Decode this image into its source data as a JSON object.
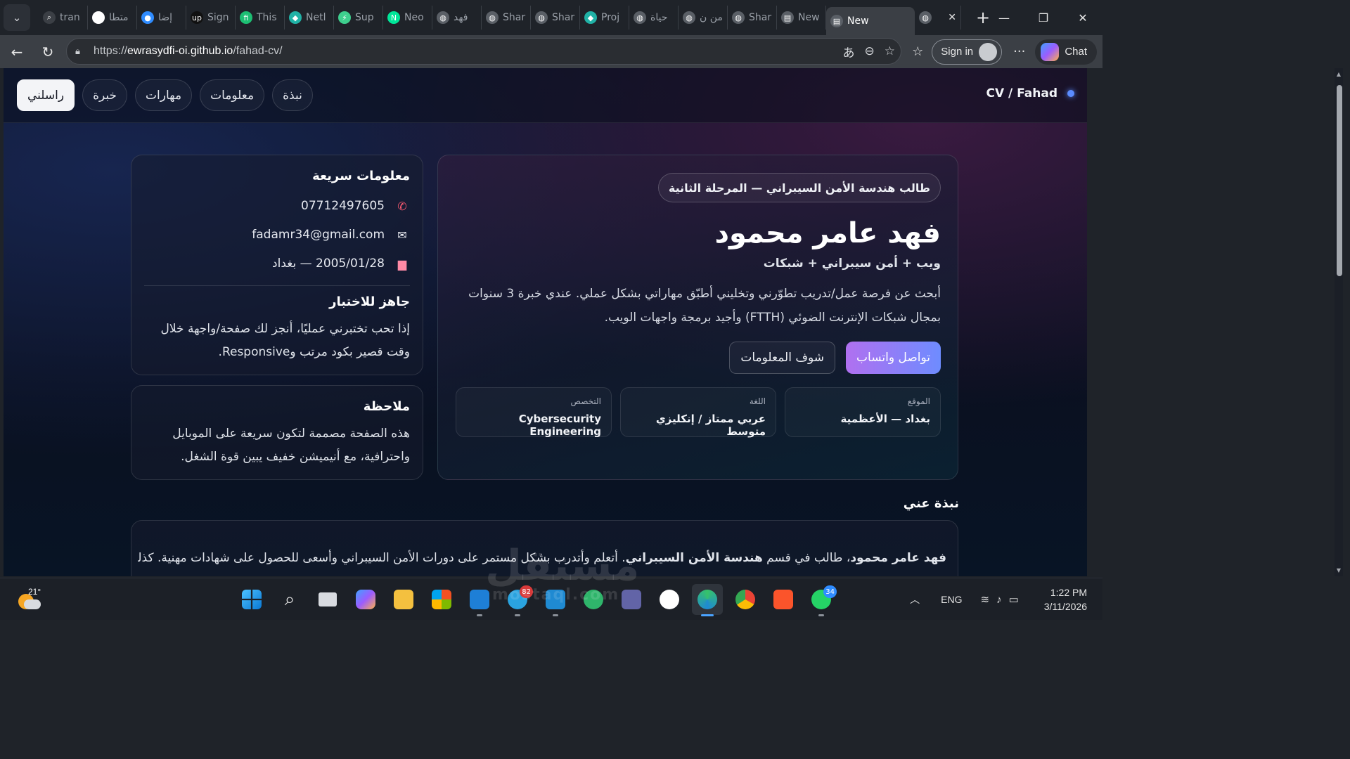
{
  "browser": {
    "tabs": [
      {
        "label": "tran",
        "icon": "search-icon",
        "color": "#3b3f45"
      },
      {
        "label": "متطا",
        "icon": "chatgpt-icon",
        "color": "#ffffff"
      },
      {
        "label": "إضا",
        "icon": "circle-app-icon",
        "color": "#2f8cff"
      },
      {
        "label": "Sign",
        "icon": "upwork-icon",
        "color": "#111111"
      },
      {
        "label": "This",
        "icon": "fiverr-icon",
        "color": "#1dbf73"
      },
      {
        "label": "Netl",
        "icon": "netlify-icon",
        "color": "#20b2a6"
      },
      {
        "label": "Sup",
        "icon": "supabase-icon",
        "color": "#3ecf8e"
      },
      {
        "label": "Neo",
        "icon": "neon-icon",
        "color": "#00e699"
      },
      {
        "label": "فهد",
        "icon": "globe-icon",
        "color": "#5a5f66"
      },
      {
        "label": "Shar",
        "icon": "globe-icon",
        "color": "#5a5f66"
      },
      {
        "label": "Shar",
        "icon": "globe-icon",
        "color": "#5a5f66"
      },
      {
        "label": "Proj",
        "icon": "netlify-icon",
        "color": "#20b2a6"
      },
      {
        "label": "حياة",
        "icon": "globe-icon",
        "color": "#5a5f66"
      },
      {
        "label": "من ن",
        "icon": "globe-icon",
        "color": "#5a5f66"
      },
      {
        "label": "Shar",
        "icon": "globe-icon",
        "color": "#5a5f66"
      },
      {
        "label": "New",
        "icon": "newtab-icon",
        "color": "#5a5f66"
      }
    ],
    "active_tab": {
      "label": "New",
      "icon": "newtab-icon"
    },
    "current_tab_icon": "globe-icon",
    "url_prefix": "https://",
    "url_domain": "ewrasydfi-oi.github.io",
    "url_path": "/fahad-cv/",
    "signin_label": "Sign in",
    "chat_label": "Chat"
  },
  "site": {
    "brand": "CV / Fahad",
    "nav": {
      "contact": "راسلني",
      "experience": "خبرة",
      "skills": "مهارات",
      "info": "معلومات",
      "about": "نبذة"
    },
    "hero": {
      "badge": "طالب هندسة الأمن السيبراني — المرحلة الثانية",
      "name": "فهد عامر محمود",
      "tagline": "ويب + أمن سيبراني + شبكات",
      "intro": "أبحث عن فرصة عمل/تدريب تطوّرني وتخليني أطبّق مهاراتي بشكل عملي. عندي خبرة 3 سنوات بمجال شبكات الإنترنت الضوئي (FTTH) وأجيد برمجة واجهات الويب.",
      "btn_whatsapp": "تواصل واتساب",
      "btn_info": "شوف المعلومات",
      "stats": [
        {
          "label": "الموقع",
          "value": "بغداد — الأعظمية"
        },
        {
          "label": "اللغة",
          "value": "عربي ممتاز / إنكليزي متوسط"
        },
        {
          "label": "التخصص",
          "value": "Cybersecurity Engineering"
        }
      ]
    },
    "quick": {
      "title": "معلومات سريعة",
      "phone": "07712497605",
      "email": "fadamr34@gmail.com",
      "birth": "2005/01/28 — بغداد",
      "ready_title": "جاهز للاختبار",
      "ready_text": "إذا تحب تختبرني عمليًا، أنجز لك صفحة/واجهة خلال وقت قصير بكود مرتب وResponsive."
    },
    "note": {
      "title": "ملاحظة",
      "text": "هذه الصفحة مصممة لتكون سريعة على الموبايل واحترافية، مع أنيميشن خفيف يبين قوة الشغل."
    },
    "about": {
      "title": "نبذة عني",
      "name_bold": "فهد عامر محمود",
      "text_mid": "، طالب في قسم ",
      "dept_bold": "هندسة الأمن السيبراني",
      "text_end": ". أتعلم وأتدرب بشكل مستمر على دورات الأمن السيبراني وأسعى للحصول على شهادات مهنية. كذلك"
    }
  },
  "taskbar": {
    "temperature": "21°",
    "language": "ENG",
    "time": "1:22 PM",
    "date": "3/11/2026",
    "telegram_badge": "82",
    "whatsapp_badge": "34",
    "watermark": "مستقل",
    "watermark_sub": "mostaql.com"
  }
}
